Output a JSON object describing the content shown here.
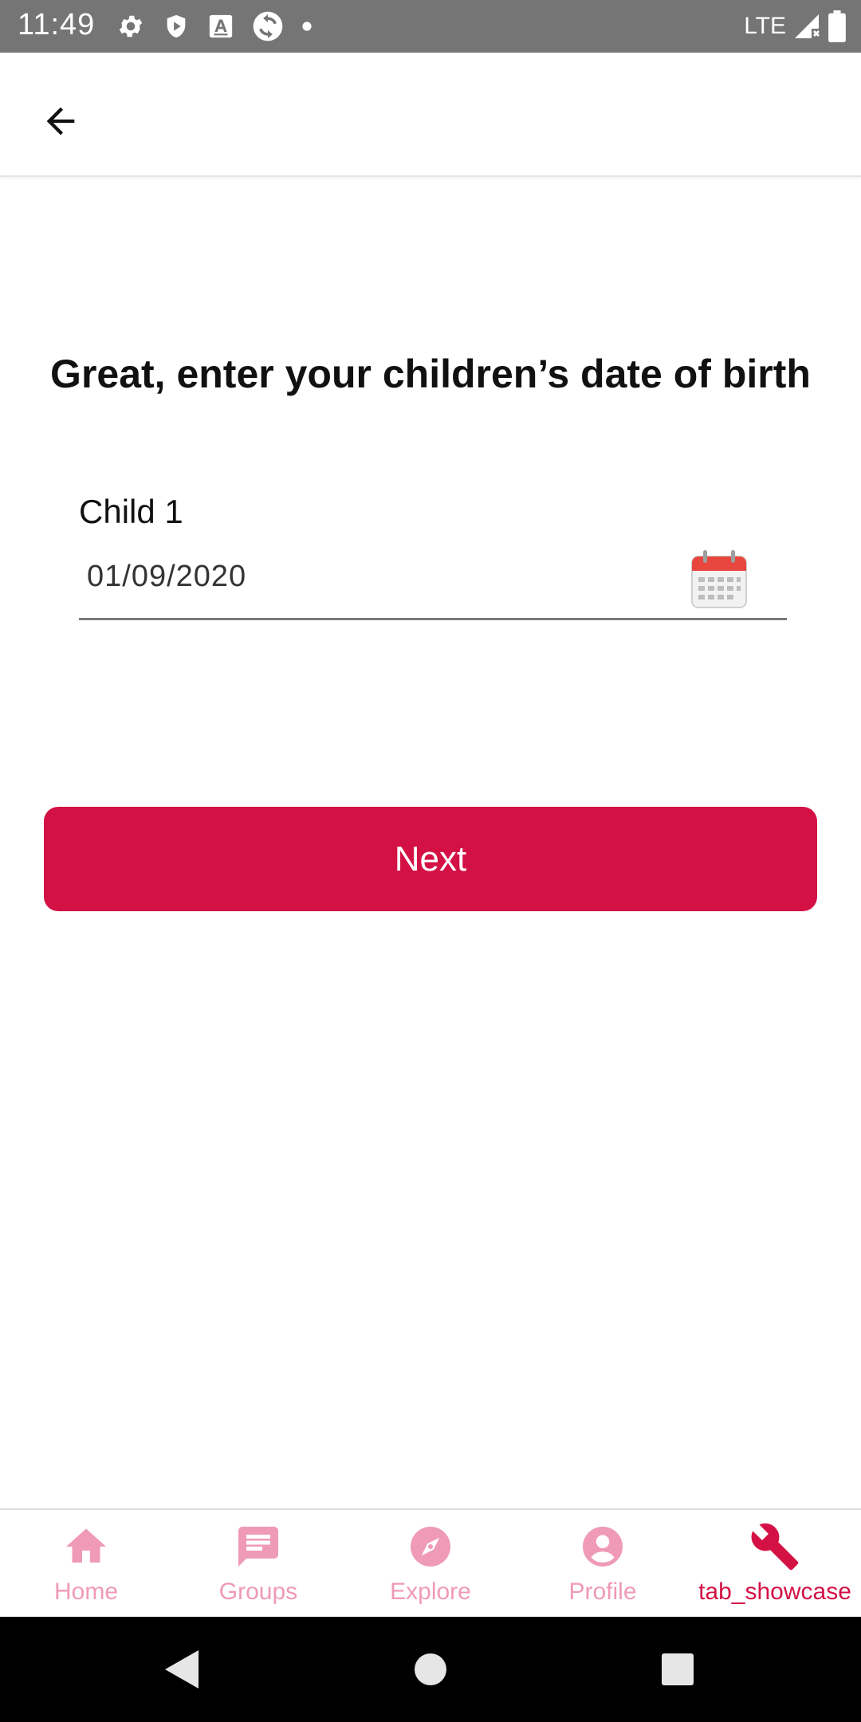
{
  "status_bar": {
    "time": "11:49",
    "network": "LTE",
    "icons": [
      "settings-icon",
      "shield-icon",
      "a-icon",
      "sync-icon",
      "dot-icon",
      "signal-icon",
      "battery-icon"
    ]
  },
  "app_bar": {
    "back_icon": "arrow-left-icon"
  },
  "main": {
    "title": "Great, enter your children’s date of birth",
    "child_label": "Child 1",
    "date_value": "01/09/2020",
    "calendar_icon": "calendar-icon",
    "next_label": "Next"
  },
  "bottom_nav": {
    "items": [
      {
        "label": "Home",
        "icon": "home-icon"
      },
      {
        "label": "Groups",
        "icon": "chat-icon"
      },
      {
        "label": "Explore",
        "icon": "compass-icon"
      },
      {
        "label": "Profile",
        "icon": "person-icon"
      },
      {
        "label": "tab_showcase",
        "icon": "wrench-icon",
        "active": true
      }
    ]
  },
  "system_nav": {
    "icons": [
      "back-triangle-icon",
      "home-circle-icon",
      "recents-square-icon"
    ]
  },
  "colors": {
    "accent": "#d31145",
    "inactive_nav": "#ef9ab6",
    "status_bar": "#757575"
  }
}
